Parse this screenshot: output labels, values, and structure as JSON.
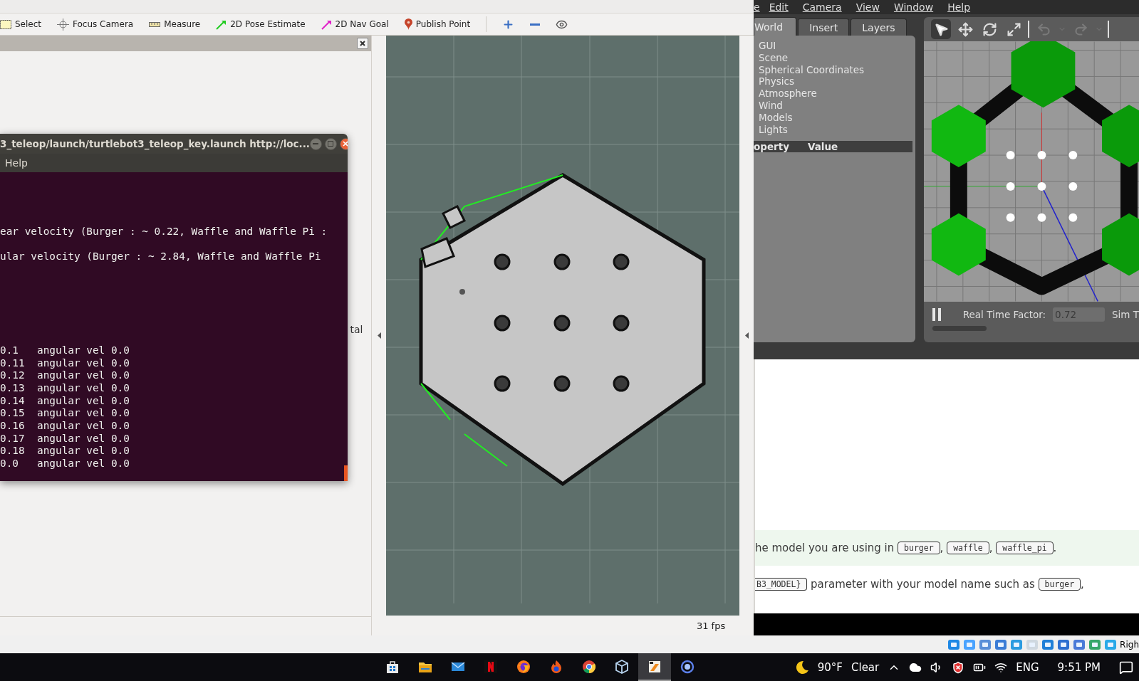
{
  "rviz": {
    "tools": [
      {
        "kind": "select",
        "label": "Select"
      },
      {
        "kind": "focus",
        "label": "Focus Camera"
      },
      {
        "kind": "measure",
        "label": "Measure"
      },
      {
        "kind": "pose",
        "label": "2D Pose Estimate"
      },
      {
        "kind": "goal",
        "label": "2D Nav Goal"
      },
      {
        "kind": "point",
        "label": "Publish Point"
      }
    ],
    "view_tools": [
      {
        "kind": "add"
      },
      {
        "kind": "remove"
      },
      {
        "kind": "eye"
      }
    ],
    "panel_text": "tal",
    "fps": "31 fps"
  },
  "terminal": {
    "title": "3_teleop/launch/turtlebot3_teleop_key.launch http://loc...",
    "menu": [
      "Help"
    ],
    "notes": [
      "ear velocity (Burger : ~ 0.22, Waffle and Waffle Pi :",
      "ular velocity (Burger : ~ 2.84, Waffle and Waffle Pi"
    ],
    "log": [
      "0.1   angular vel 0.0",
      "0.11  angular vel 0.0",
      "0.12  angular vel 0.0",
      "0.13  angular vel 0.0",
      "0.14  angular vel 0.0",
      "0.15  angular vel 0.0",
      "0.16  angular vel 0.0",
      "0.17  angular vel 0.0",
      "0.18  angular vel 0.0",
      "0.0   angular vel 0.0"
    ]
  },
  "gazebo": {
    "menu": [
      "e",
      "Edit",
      "Camera",
      "View",
      "Window",
      "Help"
    ],
    "tabs": [
      {
        "label": "World",
        "selected": true
      },
      {
        "label": "Insert",
        "selected": false
      },
      {
        "label": "Layers",
        "selected": false
      }
    ],
    "tree": [
      "GUI",
      "Scene",
      "Spherical Coordinates",
      "Physics",
      "Atmosphere",
      "Wind",
      "Models",
      "Lights"
    ],
    "columns": [
      "operty",
      "Value"
    ],
    "tools": [
      {
        "kind": "select",
        "selected": true
      },
      {
        "kind": "translate",
        "selected": false
      },
      {
        "kind": "rotate",
        "selected": false
      },
      {
        "kind": "scale",
        "selected": false
      },
      {
        "kind": "undo",
        "selected": false
      },
      {
        "kind": "redo",
        "selected": false
      }
    ],
    "rtf_label": "Real Time Factor:",
    "rtf_value": "0.72",
    "sim_label": "Sim T"
  },
  "web": {
    "lines": [
      {
        "highlight": true,
        "parts": [
          {
            "kind": "text",
            "text": "he model you are using in "
          },
          {
            "kind": "code",
            "text": "burger"
          },
          {
            "kind": "text",
            "text": ", "
          },
          {
            "kind": "code",
            "text": "waffle"
          },
          {
            "kind": "text",
            "text": ", "
          },
          {
            "kind": "code",
            "text": "waffle_pi"
          },
          {
            "kind": "text",
            "text": "."
          }
        ]
      },
      {
        "highlight": false,
        "parts": [
          {
            "kind": "code",
            "text": "B3_MODEL}"
          },
          {
            "kind": "text",
            "text": " parameter with your model name such as "
          },
          {
            "kind": "code",
            "text": "burger"
          },
          {
            "kind": "text",
            "text": ","
          }
        ]
      }
    ]
  },
  "vbox": {
    "text": "Righ"
  },
  "taskbar": {
    "apps": [
      {
        "kind": "store",
        "active": false
      },
      {
        "kind": "folder",
        "active": false
      },
      {
        "kind": "mail",
        "active": false
      },
      {
        "kind": "netflix",
        "active": false
      },
      {
        "kind": "firefox",
        "active": false
      },
      {
        "kind": "flame",
        "active": false
      },
      {
        "kind": "chrome",
        "active": false
      },
      {
        "kind": "cube",
        "active": false
      },
      {
        "kind": "xserver",
        "active": true
      },
      {
        "kind": "ring",
        "active": false
      }
    ],
    "temperature": "90°F",
    "weather": "Clear",
    "language": "ENG",
    "time": "9:51 PM"
  }
}
